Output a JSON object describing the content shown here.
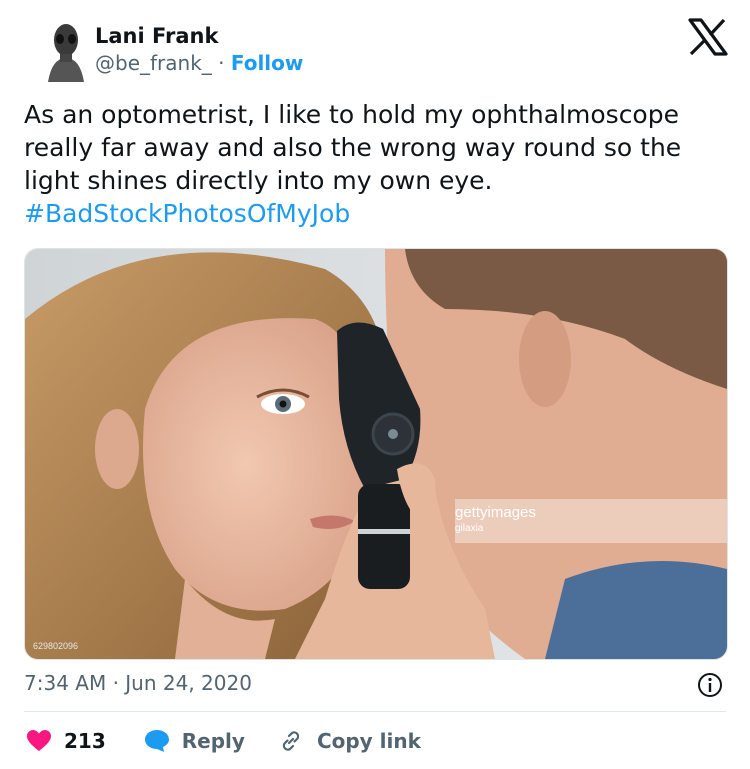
{
  "author": {
    "name": "Lani Frank",
    "handle": "@be_frank_",
    "separator": "·",
    "follow_label": "Follow"
  },
  "tweet": {
    "text": "As an optometrist, I like to hold my ophthalmoscope really far away and also the wrong way round so the light shines directly into my own eye. ",
    "hashtag": "#BadStockPhotosOfMyJob"
  },
  "media": {
    "watermark_brand": "gettyimages",
    "watermark_credit": "gilaxia",
    "watermark_id": "629802096"
  },
  "meta": {
    "timestamp": "7:34 AM · Jun 24, 2020"
  },
  "actions": {
    "like_count": "213",
    "reply_label": "Reply",
    "copy_link_label": "Copy link"
  },
  "colors": {
    "accent": "#1d9bf0",
    "like": "#f91880",
    "text": "#0f1419",
    "muted": "#536471"
  }
}
